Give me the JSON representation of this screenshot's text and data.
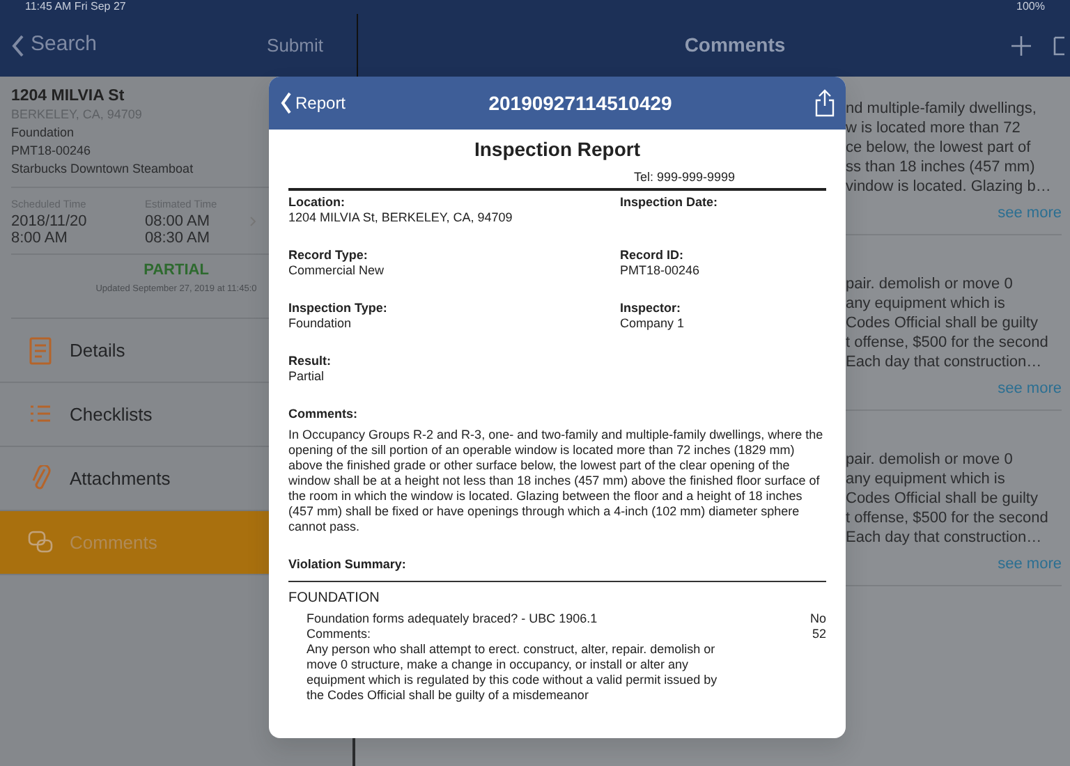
{
  "status_bar": {
    "time": "11:45 AM  Fri Sep 27",
    "battery": "100%"
  },
  "left_pane": {
    "back": "Search",
    "action": "Submit",
    "record": {
      "address": "1204 MILVIA St",
      "city": "BERKELEY, CA, 94709",
      "type": "Foundation",
      "permit": "PMT18-00246",
      "name": "Starbucks Downtown Steamboat"
    },
    "schedule": {
      "scheduled_label": "Scheduled Time",
      "scheduled_date": "2018/11/20",
      "scheduled_time": "8:00 AM",
      "estimated_label": "Estimated Time",
      "estimated_start": "08:00 AM",
      "estimated_end": "08:30 AM"
    },
    "result": {
      "status": "PARTIAL",
      "updated": "Updated September 27, 2019 at 11:45:0"
    },
    "menu": [
      {
        "kind": "details",
        "label": "Details",
        "selected": false
      },
      {
        "kind": "checklists",
        "label": "Checklists",
        "selected": false
      },
      {
        "kind": "attachments",
        "label": "Attachments",
        "selected": false
      },
      {
        "kind": "comments",
        "label": "Comments",
        "selected": true
      }
    ]
  },
  "right_pane": {
    "title": "Comments",
    "comments": [
      {
        "lines": [
          "nd multiple-family dwellings,",
          "w is located more than 72",
          "ce below, the lowest part of",
          "ss than 18 inches (457 mm)",
          "vindow is located. Glazing b…"
        ],
        "link": "see more"
      },
      {
        "lines": [
          "pair. demolish or move 0",
          "any equipment which is",
          "Codes Official shall be guilty",
          "t offense, $500 for the second",
          "Each day that construction…"
        ],
        "link": "see more"
      },
      {
        "lines": [
          "pair. demolish or move 0",
          "any equipment which is",
          "Codes Official shall be guilty",
          "t offense, $500 for the second",
          "Each day that construction…"
        ],
        "link": "see more"
      }
    ]
  },
  "modal": {
    "back": "Report",
    "title": "20190927114510429",
    "report": {
      "heading": "Inspection Report",
      "tel": "Tel: 999-999-9999",
      "fields": [
        {
          "label": "Location:",
          "value": "1204 MILVIA St, BERKELEY, CA, 94709"
        },
        {
          "label": "Inspection Date:"
        },
        {
          "label": "Record Type:",
          "value": "Commercial New"
        },
        {
          "label": "Record ID:",
          "value": "PMT18-00246"
        },
        {
          "label": "Inspection Type:",
          "value": "Foundation"
        },
        {
          "label": "Inspector:",
          "value": "Company 1"
        },
        {
          "label": "Result:",
          "value": "Partial"
        }
      ],
      "comments_label": "Comments:",
      "comments": "In Occupancy Groups R-2 and R-3, one- and two-family and multiple-family dwellings, where the opening of the sill portion of an operable window is located more than 72 inches (1829 mm) above the finished grade or other surface below, the lowest part of the clear opening of the window shall be at a height not less than 18 inches (457 mm) above the finished floor surface of the room in which the window is located. Glazing between the floor and a height of 18 inches (457 mm) shall be fixed or have openings through which a 4-inch (102 mm) diameter sphere cannot pass.",
      "violation_label": "Violation Summary:",
      "group": "FOUNDATION",
      "item": {
        "question": "Foundation forms adequately braced? - UBC 1906.1",
        "answer": "No",
        "comments_label": "Comments:",
        "score": "52",
        "comment": "Any person who shall attempt to erect. construct, alter, repair. demolish or move 0 structure, make a change in occupancy, or install or alter any equipment which is regulated by this code without a valid permit issued by the Codes Official shall be guilty of a misdemeanor"
      }
    }
  }
}
